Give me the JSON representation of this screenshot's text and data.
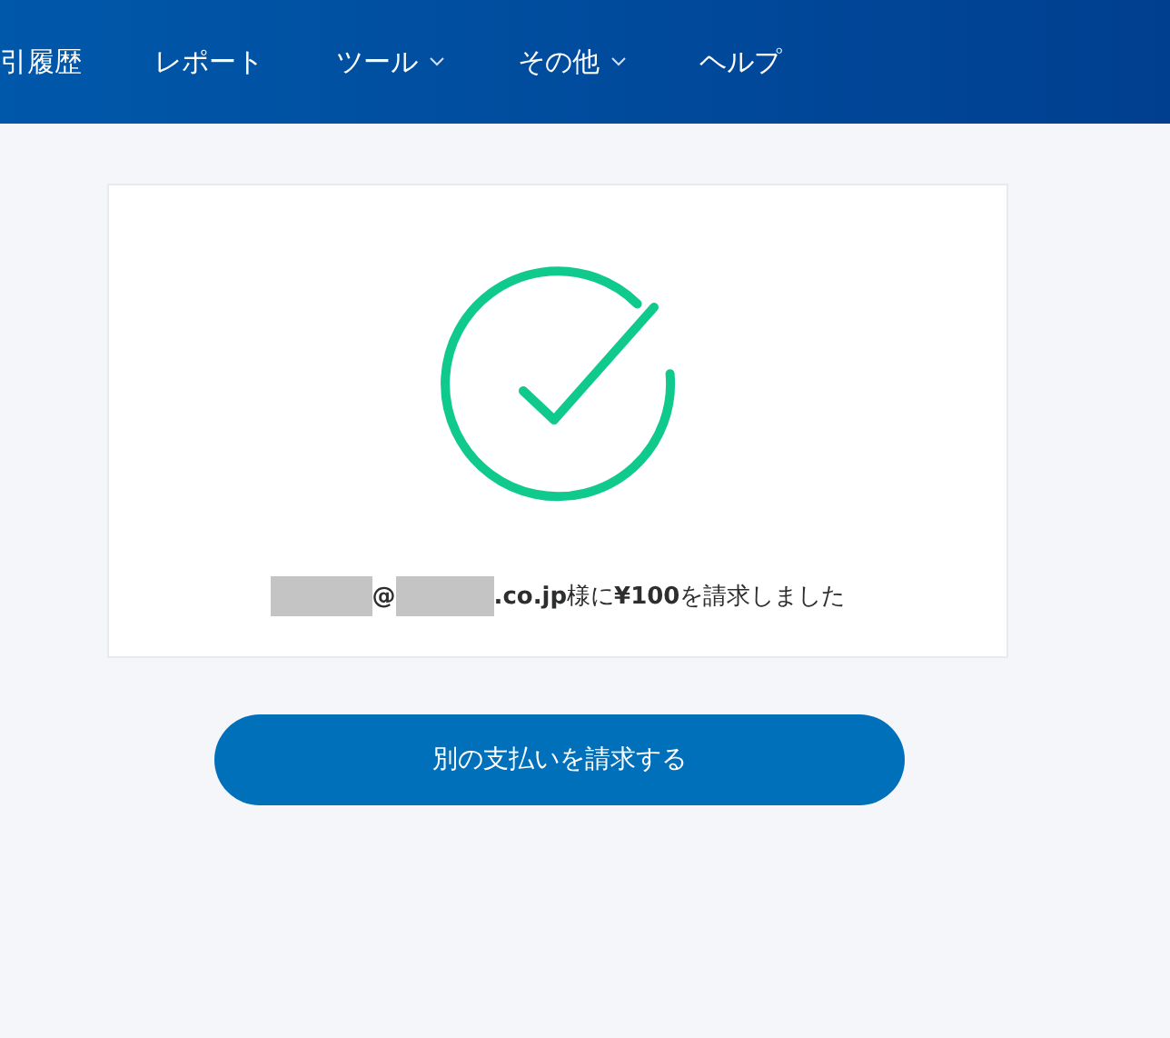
{
  "nav": {
    "items": [
      {
        "label": "引履歴",
        "dropdown": false
      },
      {
        "label": "レポート",
        "dropdown": false
      },
      {
        "label": "ツール",
        "dropdown": true
      },
      {
        "label": "その他",
        "dropdown": true
      },
      {
        "label": "ヘルプ",
        "dropdown": false
      }
    ]
  },
  "message": {
    "parts": [
      {
        "kind": "redacted"
      },
      {
        "kind": "text",
        "text": "@",
        "bold": true
      },
      {
        "kind": "redacted"
      },
      {
        "kind": "text",
        "text": "**.co.jp**様に**¥100**を請求しました",
        "bold": false
      }
    ]
  },
  "button": {
    "label": "別の支払いを請求する"
  }
}
